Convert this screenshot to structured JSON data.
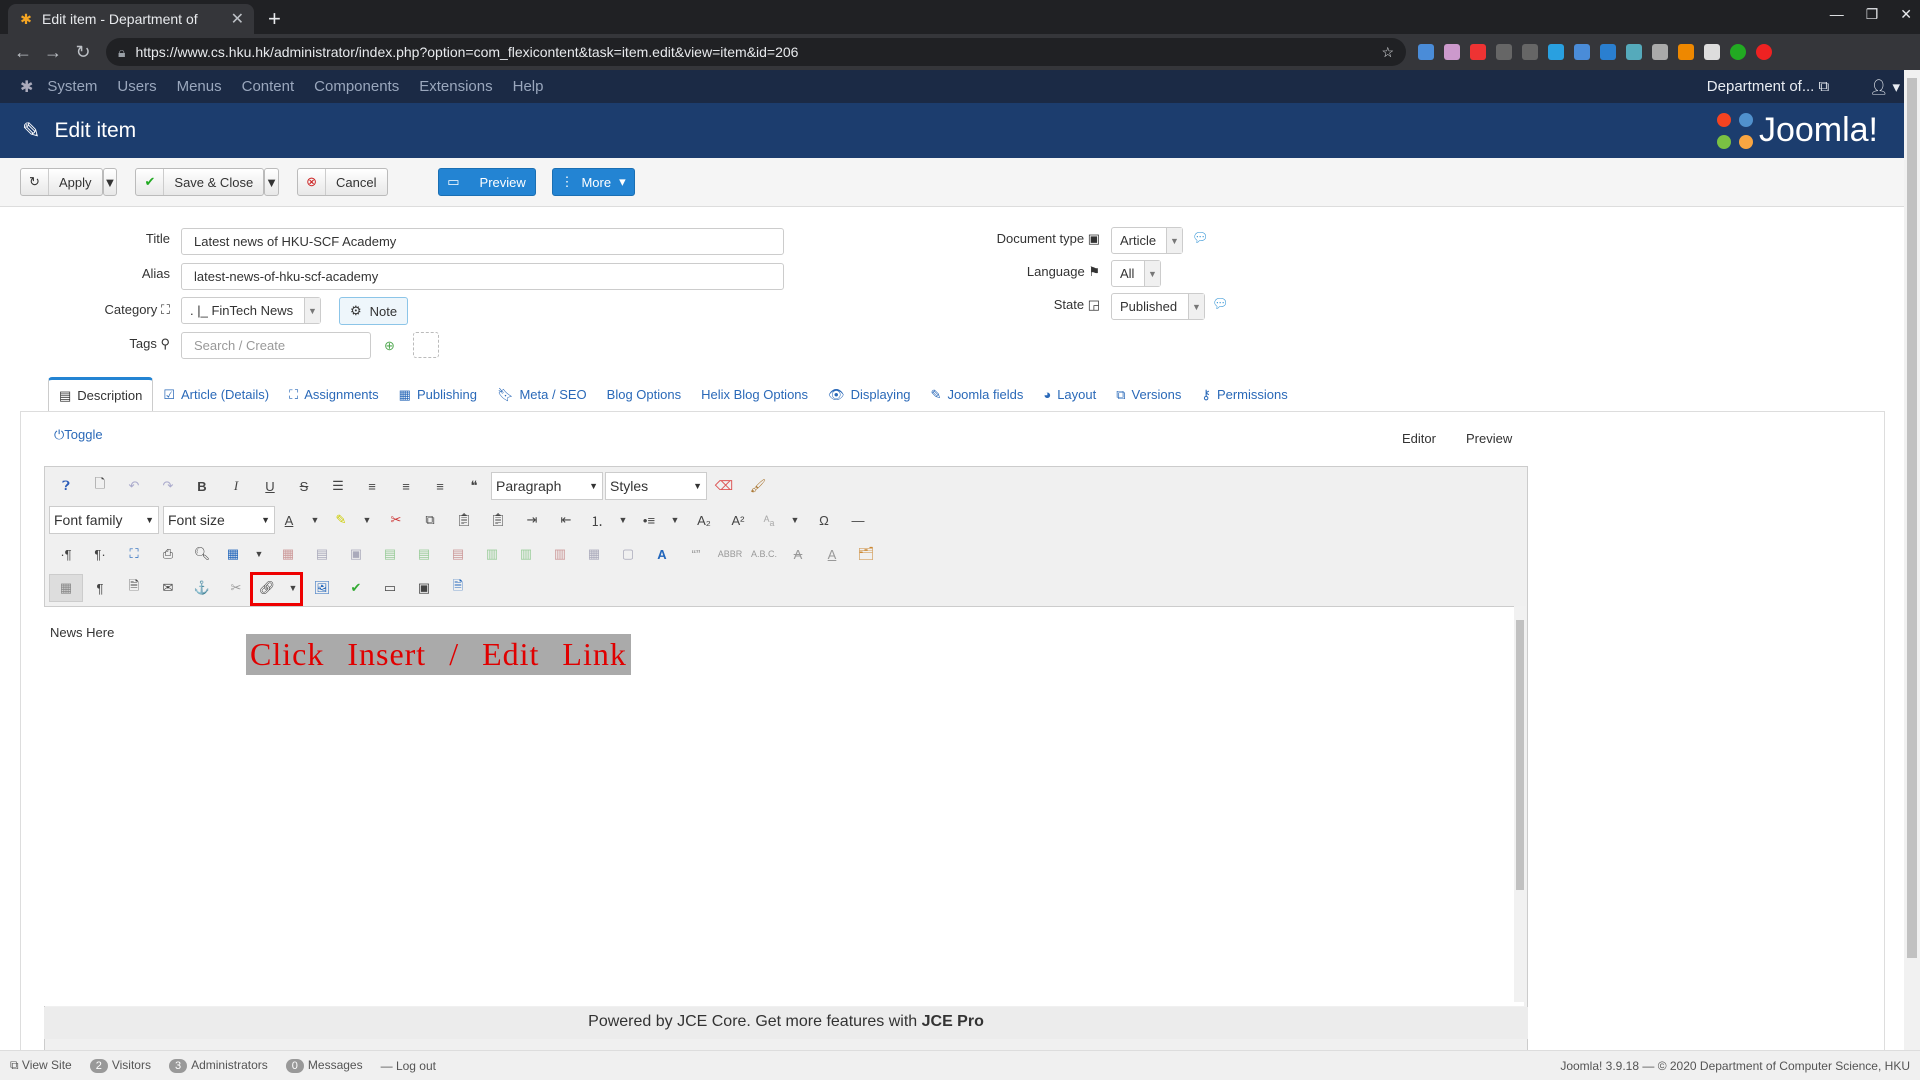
{
  "browser": {
    "tab_title": "Edit item - Department of",
    "url": "https://www.cs.hku.hk/administrator/index.php?option=com_flexicontent&task=item.edit&view=item&id=206"
  },
  "adminbar": {
    "menu": [
      "System",
      "Users",
      "Menus",
      "Content",
      "Components",
      "Extensions",
      "Help"
    ],
    "site_name": "Department of..."
  },
  "header": {
    "title": "Edit item",
    "brand": "Joomla!"
  },
  "toolbar": {
    "apply": "Apply",
    "save_close": "Save & Close",
    "cancel": "Cancel",
    "preview": "Preview",
    "more": "More"
  },
  "form": {
    "title_label": "Title",
    "title_value": "Latest news of HKU-SCF Academy",
    "alias_label": "Alias",
    "alias_value": "latest-news-of-hku-scf-academy",
    "category_label": "Category",
    "category_value": ". |_ FinTech News",
    "note_label": "Note",
    "tags_label": "Tags",
    "tags_placeholder": "Search / Create",
    "doctype_label": "Document type",
    "doctype_value": "Article",
    "language_label": "Language",
    "language_value": "All",
    "state_label": "State",
    "state_value": "Published"
  },
  "tabs": [
    "Description",
    "Article (Details)",
    "Assignments",
    "Publishing",
    "Meta / SEO",
    "Blog Options",
    "Helix Blog Options",
    "Displaying",
    "Joomla fields",
    "Layout",
    "Versions",
    "Permissions"
  ],
  "editor": {
    "toggle": "Toggle",
    "mode_editor": "Editor",
    "mode_preview": "Preview",
    "paragraph": "Paragraph",
    "styles": "Styles",
    "font_family": "Font family",
    "font_size": "Font size",
    "content": "News Here",
    "annotation": "Click Insert / Edit Link",
    "powered_prefix": "Powered by JCE Core. Get more features with ",
    "powered_link": "JCE Pro"
  },
  "footer": {
    "view_site": "View Site",
    "visitors_count": "2",
    "visitors": "Visitors",
    "admins_count": "3",
    "admins": "Administrators",
    "messages_count": "0",
    "messages": "Messages",
    "logout": "Log out",
    "version": "Joomla! 3.9.18 — © 2020 Department of Computer Science, HKU"
  }
}
